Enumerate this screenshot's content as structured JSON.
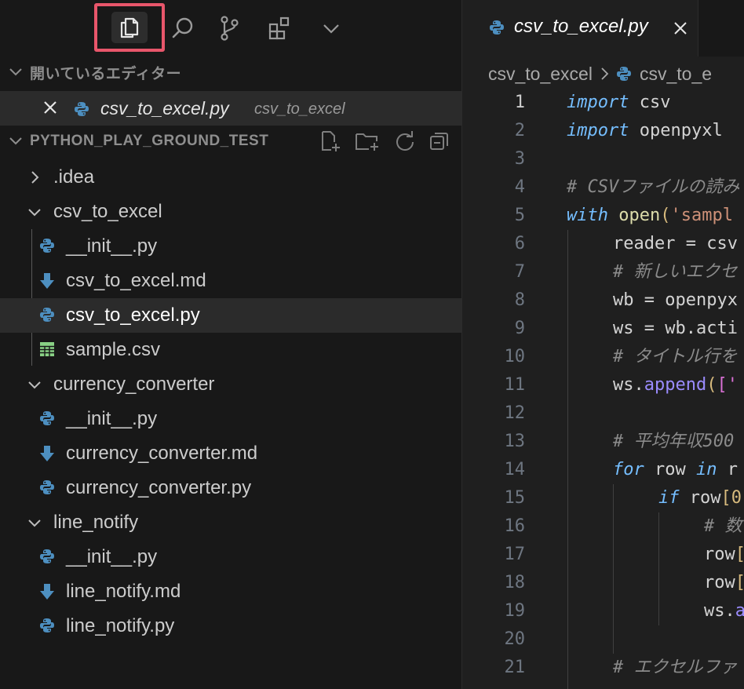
{
  "sidebar": {
    "open_editors": {
      "title": "開いているエディター",
      "items": [
        {
          "name": "csv_to_excel.py",
          "description": "csv_to_excel"
        }
      ]
    },
    "project": {
      "title": "PYTHON_PLAY_GROUND_TEST",
      "tree": [
        {
          "label": ".idea"
        },
        {
          "label": "csv_to_excel"
        },
        {
          "label": "__init__.py"
        },
        {
          "label": "csv_to_excel.md"
        },
        {
          "label": "csv_to_excel.py"
        },
        {
          "label": "sample.csv"
        },
        {
          "label": "currency_converter"
        },
        {
          "label": "__init__.py"
        },
        {
          "label": "currency_converter.md"
        },
        {
          "label": "currency_converter.py"
        },
        {
          "label": "line_notify"
        },
        {
          "label": "__init__.py"
        },
        {
          "label": "line_notify.md"
        },
        {
          "label": "line_notify.py"
        }
      ]
    }
  },
  "editor": {
    "tab": {
      "name": "csv_to_excel.py"
    },
    "breadcrumb": [
      "csv_to_excel",
      "csv_to_e"
    ],
    "line_numbers": [
      "1",
      "2",
      "3",
      "4",
      "5",
      "6",
      "7",
      "8",
      "9",
      "10",
      "11",
      "12",
      "13",
      "14",
      "15",
      "16",
      "17",
      "18",
      "19",
      "20",
      "21"
    ],
    "current_line": "1",
    "code": {
      "l1": {
        "kw": "import",
        "rest": " csv"
      },
      "l2": {
        "kw": "import",
        "rest": " openpyxl"
      },
      "l4": "# CSVファイルの読み",
      "l5": {
        "kw": "with",
        "fn": "open",
        "paren": "(",
        "str": "'sampl"
      },
      "l6": "reader = csv",
      "l7": "# 新しいエクセ",
      "l8": "wb = openpyx",
      "l9": "ws = wb.acti",
      "l10": "# タイトル行を",
      "l11": {
        "obj": "ws.",
        "method": "append",
        "paren": "(",
        "bracket": "['"
      },
      "l13": "# 平均年収500",
      "l14": {
        "kw": "for",
        "mid": " row ",
        "kw2": "in",
        "rest": " r"
      },
      "l15": {
        "kw": "if",
        "rest": " row",
        "bracket": "[0"
      },
      "l16": "# 数",
      "l17": {
        "rest": "row",
        "bracket": "["
      },
      "l18": {
        "rest": "row",
        "bracket": "["
      },
      "l19": {
        "obj": "ws.",
        "method": "a"
      },
      "l21": "# エクセルファ"
    }
  },
  "colors": {
    "accent_highlight": "#e8566b",
    "sidebar_bg": "#181818",
    "editor_bg": "#1f1f1f",
    "selection_bg": "#2b2b2b",
    "python_icon": "#4d8fc0",
    "markdown_icon": "#4d8fc0",
    "csv_icon": "#89d185"
  },
  "icons": {
    "activity_bar": [
      "explorer-icon",
      "search-icon",
      "source-control-icon",
      "extensions-icon",
      "chevron-down-icon"
    ],
    "project_actions": [
      "new-file-icon",
      "new-folder-icon",
      "refresh-icon",
      "collapse-all-icon"
    ]
  }
}
